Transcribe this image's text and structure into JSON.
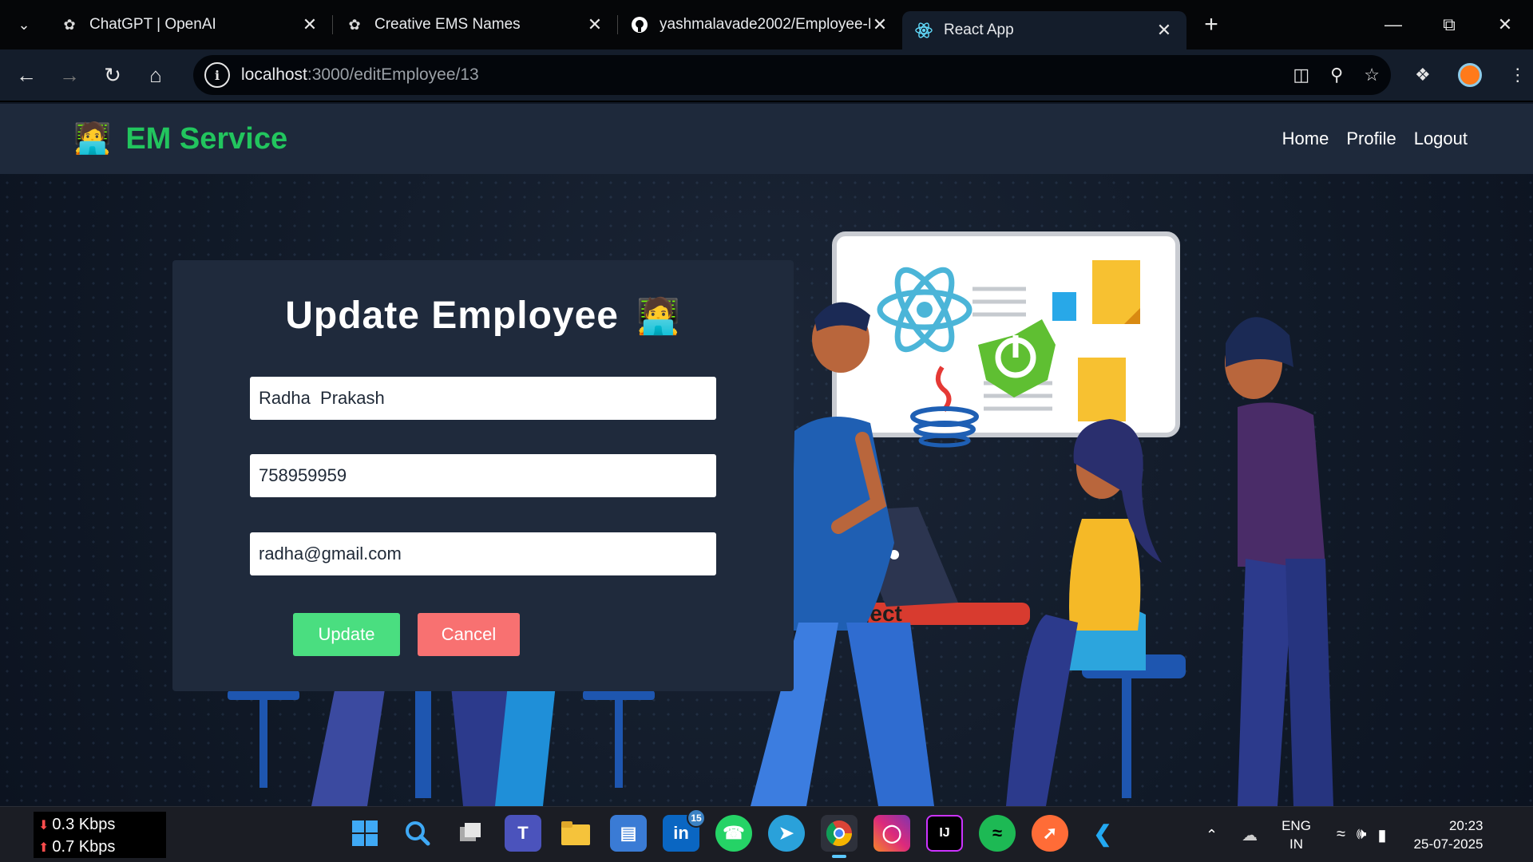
{
  "browser": {
    "tabs": [
      {
        "title": "ChatGPT | OpenAI",
        "icon": "openai-icon",
        "active": false
      },
      {
        "title": "Creative EMS Names",
        "icon": "openai-icon",
        "active": false
      },
      {
        "title": "yashmalavade2002/Employee-M",
        "icon": "github-icon",
        "active": false
      },
      {
        "title": "React App",
        "icon": "react-icon",
        "active": true
      }
    ],
    "url_host": "localhost",
    "url_path": ":3000/editEmployee/13"
  },
  "app": {
    "brand": "EM Service",
    "brand_emoji": "🧑‍💻",
    "nav": {
      "home": "Home",
      "profile": "Profile",
      "logout": "Logout"
    },
    "accent_color": "#22c55e"
  },
  "form": {
    "title": "Update Employee",
    "title_emoji": "🧑‍💻",
    "name_value": "Radha  Prakash",
    "phone_value": "758959959",
    "email_value": "radha@gmail.com",
    "update_label": "Update",
    "cancel_label": "Cancel",
    "update_color": "#4ade80",
    "cancel_color": "#f87171"
  },
  "illustration": {
    "banner_text": ".js Project"
  },
  "taskbar": {
    "net_down": "0.3 Kbps",
    "net_up": "0.7 Kbps",
    "linkedin_badge": "15",
    "lang_top": "ENG",
    "lang_bottom": "IN",
    "time": "20:23",
    "date": "25-07-2025"
  }
}
